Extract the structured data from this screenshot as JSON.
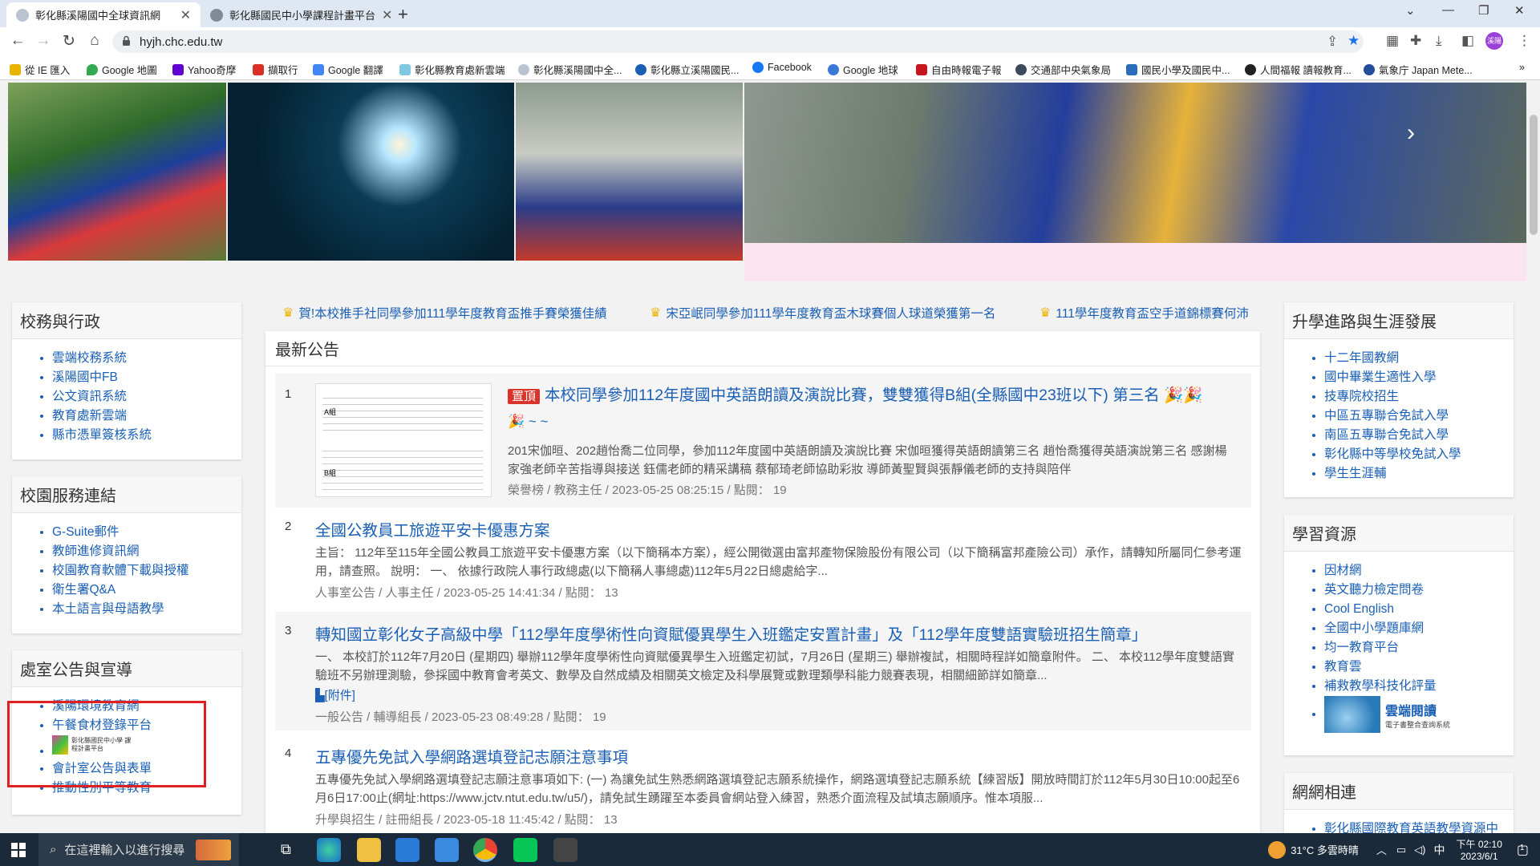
{
  "browser": {
    "tabs": [
      {
        "label": "彰化縣溪陽國中全球資訊網",
        "active": true
      },
      {
        "label": "彰化縣國民中小學課程計畫平台",
        "active": false
      }
    ],
    "url": "hyjh.chc.edu.tw",
    "bookmarks": [
      "從 IE 匯入",
      "Google 地圖",
      "Yahoo奇摩",
      "擷取行",
      "Google 翻譯",
      "彰化縣教育處新雲端",
      "彰化縣溪陽國中全...",
      "彰化縣立溪陽國民...",
      "Facebook",
      "Google 地球",
      "自由時報電子報",
      "交通部中央氣象局",
      "國民小學及國民中...",
      "人間福報 讀報教育...",
      "氣象庁 Japan Mete..."
    ],
    "profile_initial": "溪陽"
  },
  "marquee": [
    "賀!本校推手社同學參加111學年度教育盃推手賽榮獲佳績",
    "宋亞岷同學參加111學年度教育盃木球賽個人球道榮獲第一名",
    "111學年度教育盃空手道錦標賽何沛"
  ],
  "left": {
    "admin": {
      "title": "校務與行政",
      "items": [
        "雲端校務系統",
        "溪陽國中FB",
        "公文資訊系統",
        "教育處新雲端",
        "縣市憑單簽核系統"
      ]
    },
    "services": {
      "title": "校園服務連結",
      "items": [
        "G-Suite郵件",
        "教師進修資訊網",
        "校園教育軟體下載與授權",
        "衛生署Q&A",
        "本土語言與母語教學"
      ]
    },
    "offices": {
      "title": "處室公告與宣導",
      "items": [
        "溪陽環境教育網",
        "午餐食材登錄平台",
        "會計室公告與表單",
        "推動性別平等教育"
      ],
      "image_caption": "彰化縣國民中小學 課程計畫平台"
    }
  },
  "news": {
    "title": "最新公告",
    "pinned_label": "置頂",
    "items": [
      {
        "num": "1",
        "title": "本校同學參加112年度國中英語朗讀及演說比賽，雙雙獲得B組(全縣國中23班以下) 第三名",
        "title2": "~ ~",
        "body": "201宋伽晅、202趙怡喬二位同學，參加112年度國中英語朗讀及演說比賽 宋伽晅獲得英語朗讀第三名 趙怡喬獲得英語演說第三名 感謝楊家強老師辛苦指導與接送 鈺儒老師的精采講稿 蔡郁琦老師協助彩妝 導師黃聖賢與張靜儀老師的支持與陪伴",
        "meta": "榮譽榜 / 教務主任 / 2023-05-25 08:25:15 / 點閱： 19",
        "thumb_label_a": "A組",
        "thumb_label_b": "B組"
      },
      {
        "num": "2",
        "title": "全國公教員工旅遊平安卡優惠方案",
        "body": "主旨： 112年至115年全國公教員工旅遊平安卡優惠方案（以下簡稱本方案），經公開徵選由富邦產物保險股份有限公司（以下簡稱富邦產險公司）承作，請轉知所屬同仁參考運用，請查照。 說明： 一、 依據行政院人事行政總處(以下簡稱人事總處)112年5月22日總處給字...",
        "meta": "人事室公告 / 人事主任 / 2023-05-25 14:41:34 / 點閱： 13"
      },
      {
        "num": "3",
        "title": "轉知國立彰化女子高級中學「112學年度學術性向資賦優異學生入班鑑定安置計畫」及「112學年度雙語實驗班招生簡章」",
        "body": "一、 本校訂於112年7月20日 (星期四) 舉辦112學年度學術性向資賦優異學生入班鑑定初試，7月26日 (星期三) 舉辦複試，相關時程詳如簡章附件。 二、 本校112學年度雙語實驗班不另辦理測驗，參採國中教育會考英文、數學及自然成績及相關英文檢定及科學展覽或數理類學科能力競賽表現，相關細節詳如簡章...",
        "attachment": "[附件]",
        "meta": "一般公告 / 輔導組長 / 2023-05-23 08:49:28 / 點閱： 19"
      },
      {
        "num": "4",
        "title": "五專優先免試入學網路選填登記志願注意事項",
        "body": "五專優先免試入學網路選填登記志願注意事項如下: (一) 為讓免試生熟悉網路選填登記志願系統操作，網路選填登記志願系統【練習版】開放時間訂於112年5月30日10:00起至6月6日17:00止(網址:https://www.jctv.ntut.edu.tw/u5/)，請免試生踴躍至本委員會網站登入練習，熟悉介面流程及試填志願順序。惟本項服...",
        "meta": "升學與招生 / 註冊組長 / 2023-05-18 11:45:42 / 點閱： 13"
      }
    ]
  },
  "right": {
    "career": {
      "title": "升學進路與生涯發展",
      "items": [
        "十二年國教網",
        "國中畢業生適性入學",
        "技專院校招生",
        "中區五專聯合免試入學",
        "南區五專聯合免試入學",
        "彰化縣中等學校免試入學",
        "學生生涯輔"
      ]
    },
    "learning": {
      "title": "學習資源",
      "items": [
        "因材網",
        "英文聽力檢定問卷",
        "Cool English",
        "全國中小學題庫網",
        "均一教育平台",
        "教育雲",
        "補救教學科技化評量"
      ],
      "cloud_read_title": "雲端閱讀",
      "cloud_read_sub": "電子書整合查詢系統"
    },
    "links": {
      "title": "網網相連",
      "items": [
        "彰化縣國際教育英語教學資源中"
      ]
    }
  },
  "taskbar": {
    "search_placeholder": "在這裡輸入以進行搜尋",
    "weather": "31°C 多雲時晴",
    "ime": "中",
    "time": "下午 02:10",
    "date": "2023/6/1",
    "notif_count": "1"
  }
}
